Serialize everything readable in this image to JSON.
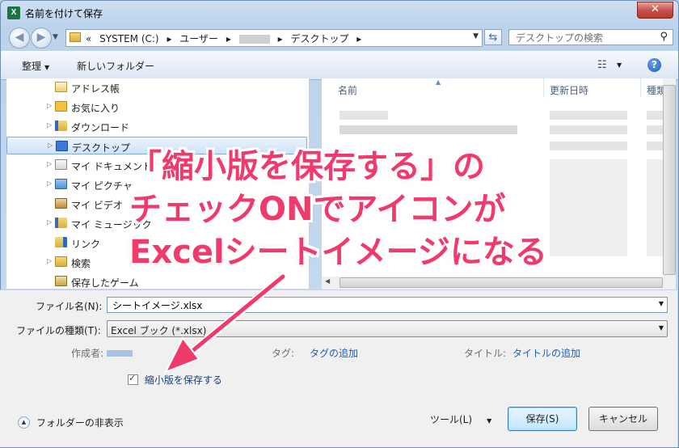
{
  "window": {
    "title": "名前を付けて保存",
    "app_icon": "excel-icon",
    "close_label": "✕"
  },
  "address": {
    "crumbs": [
      "«",
      "SYSTEM (C:)",
      "▸",
      "ユーザー",
      "▸",
      "▸",
      "デスクトップ",
      "▸"
    ],
    "search_placeholder": "デスクトップの検索"
  },
  "toolbar": {
    "organize": "整理",
    "new_folder": "新しいフォルダー"
  },
  "tree": {
    "items": [
      {
        "label": "アドレス帳",
        "icon": "address-book-icon"
      },
      {
        "label": "お気に入り",
        "icon": "favorites-icon"
      },
      {
        "label": "ダウンロード",
        "icon": "downloads-icon"
      },
      {
        "label": "デスクトップ",
        "icon": "desktop-icon"
      },
      {
        "label": "マイ ドキュメント",
        "icon": "documents-icon"
      },
      {
        "label": "マイ ピクチャ",
        "icon": "pictures-icon"
      },
      {
        "label": "マイ ビデオ",
        "icon": "videos-icon"
      },
      {
        "label": "マイ ミュージック",
        "icon": "music-icon"
      },
      {
        "label": "リンク",
        "icon": "links-icon"
      },
      {
        "label": "検索",
        "icon": "searches-icon"
      },
      {
        "label": "保存したゲーム",
        "icon": "saved-games-icon"
      }
    ]
  },
  "filelist": {
    "col_name": "名前",
    "col_date": "更新日時",
    "col_type": "種類"
  },
  "form": {
    "filename_label": "ファイル名(N):",
    "filename_value": "シートイメージ.xlsx",
    "filetype_label": "ファイルの種類(T):",
    "filetype_value": "Excel ブック (*.xlsx)",
    "author_label": "作成者:",
    "tags_label": "タグ:",
    "tags_link": "タグの追加",
    "title_label": "タイトル:",
    "title_link": "タイトルの追加",
    "thumbnail_label": "縮小版を保存する",
    "thumbnail_checked": true,
    "hide_folders": "フォルダーの非表示",
    "tools": "ツール(L)",
    "save": "保存(S)",
    "cancel": "キャンセル"
  },
  "annotation": {
    "lines": [
      "「縮小版を保存する」の",
      "チェックONでアイコンが",
      "Excelシートイメージになる"
    ],
    "color": "#f03a6b"
  }
}
